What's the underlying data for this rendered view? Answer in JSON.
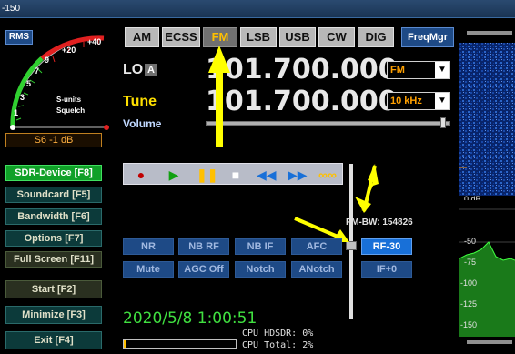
{
  "topbar": {
    "label": "-150"
  },
  "smeter": {
    "rms_label": "RMS",
    "scale_top": [
      "+40",
      "+20",
      "9",
      "7",
      "5",
      "3",
      "1"
    ],
    "units_label": "S-units",
    "squelch_label": "Squelch",
    "reading": "S6 -1 dB"
  },
  "left_buttons": [
    {
      "label": "SDR-Device [F8]",
      "active": true
    },
    {
      "label": "Soundcard  [F5]"
    },
    {
      "label": "Bandwidth  [F6]"
    },
    {
      "label": "Options    [F7]"
    },
    {
      "label": "Full Screen [F11]"
    },
    {
      "label": "Start      [F2]"
    },
    {
      "label": "Minimize   [F3]"
    },
    {
      "label": "Exit       [F4]"
    }
  ],
  "modes": [
    "AM",
    "ECSS",
    "FM",
    "LSB",
    "USB",
    "CW",
    "DIG"
  ],
  "active_mode": "FM",
  "freqmgr_label": "FreqMgr",
  "lo": {
    "label": "LO",
    "badge": "A",
    "freq": "101.700.000",
    "dropdown": "FM"
  },
  "tune": {
    "label": "Tune",
    "freq": "101.700.000",
    "dropdown": "10 kHz"
  },
  "volume": {
    "label": "Volume",
    "level": 0.98
  },
  "fm_bw": "FM-BW: 154826",
  "dsp_row1": [
    "NR",
    "NB RF",
    "NB IF",
    "AFC",
    "RF-30"
  ],
  "dsp_row2": [
    "Mute",
    "AGC Off",
    "Notch",
    "ANotch",
    "IF+0"
  ],
  "clock": "2020/5/8 1:00:51",
  "cpu": {
    "hdsdr": "CPU HDSDR:  0%",
    "total": "CPU Total:  2%"
  },
  "spectrum_db": [
    "-50",
    "-75",
    "-100",
    "-125",
    "-150"
  ],
  "waterfall_db": "0 dB",
  "colors": {
    "accent": "#ffc000",
    "active_green": "#10a028",
    "blue_btn": "#1e4a86"
  }
}
